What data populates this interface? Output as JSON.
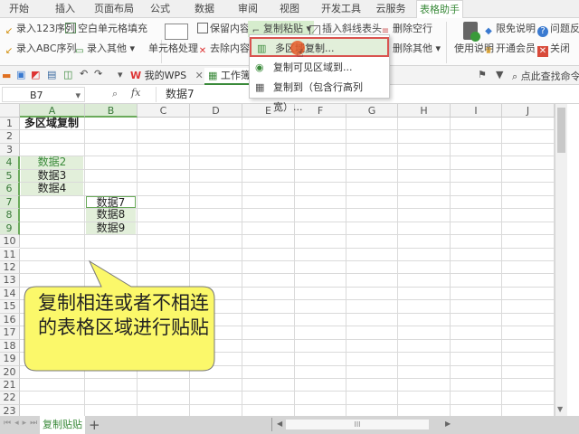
{
  "tabs": [
    "开始",
    "插入",
    "页面布局",
    "公式",
    "数据",
    "审阅",
    "视图",
    "开发工具",
    "云服务",
    "表格助手"
  ],
  "active_tab": "表格助手",
  "ribbon": {
    "seq123": "录入123序列",
    "seqabc": "录入ABC序列",
    "fill_blank": "空白单元格填充",
    "input_other": "录入其他",
    "cell_process": "单元格处理",
    "keep_content": "保留内容",
    "remove_content": "去除内容",
    "copy_paste": "复制粘贴",
    "insert_diag": "插入斜线表头",
    "delete_blank_rows": "删除空行",
    "delete_other": "删除其他",
    "usage": "使用说明",
    "disclaimer": "限免说明",
    "faq": "问题反",
    "open_vip": "开通会员",
    "close": "关闭"
  },
  "quick_access": {
    "doc_tab_wps": "我的WPS",
    "doc_tab_work": "工作簿",
    "search_cmd": "点此查找命令"
  },
  "formula_bar": {
    "name_box": "B7",
    "fx": "fx",
    "value": "数据7"
  },
  "dropdown": {
    "items": [
      "多区域复制...",
      "复制可见区域到...",
      "复制到（包含行高列宽）..."
    ],
    "highlighted": 0
  },
  "columns": [
    "A",
    "B",
    "C",
    "D",
    "E",
    "F",
    "G",
    "H",
    "I",
    "J"
  ],
  "rows": [
    "1",
    "2",
    "3",
    "4",
    "5",
    "6",
    "7",
    "8",
    "9",
    "10",
    "11",
    "12",
    "13",
    "14",
    "15",
    "16",
    "17",
    "18",
    "19",
    "20",
    "21",
    "22",
    "23"
  ],
  "cells": {
    "A1": "多区域复制",
    "A4": "数据2",
    "A5": "数据3",
    "A6": "数据4",
    "B7": "数据7",
    "B8": "数据8",
    "B9": "数据9"
  },
  "callout": "复制相连或者不相连的表格区域进行贴贴",
  "sheet_tab": "复制贴贴",
  "add_sheet": "+",
  "colors": {
    "accent": "#3a8a3a",
    "selection": "#e2efda",
    "callout": "#fbf86a",
    "menu_highlight": "#d9534f"
  }
}
